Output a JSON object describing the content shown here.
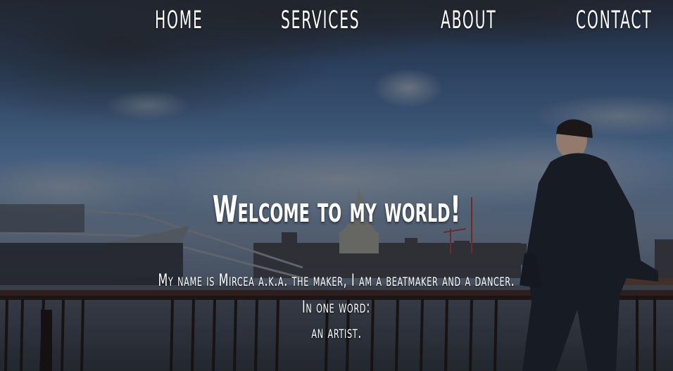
{
  "nav": {
    "home": "Home",
    "services": "Services",
    "about": "About",
    "contact": "Contact"
  },
  "hero": {
    "title": "Welcome to my world!",
    "line1": "My name is Mircea a.k.a. the maker, I am a beatmaker and a dancer.",
    "line2": "In one word:",
    "line3": "an artist."
  },
  "colors": {
    "text": "#ffffff",
    "sky_top": "#1f2a3a",
    "sky_mid": "#4a6d99",
    "water": "#3a3f48",
    "railing": "#2b1e1c"
  }
}
